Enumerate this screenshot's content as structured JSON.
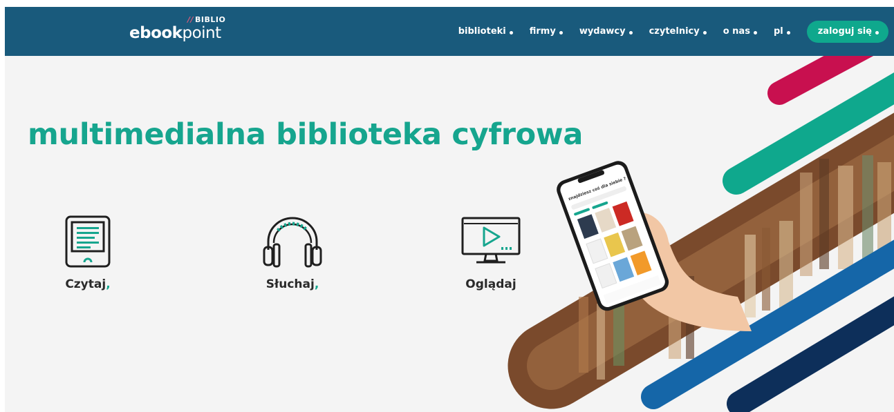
{
  "header": {
    "logo": {
      "biblio": "BIBLIO",
      "brand_bold": "ebook",
      "brand_light": "point"
    },
    "nav": [
      {
        "label": "biblioteki"
      },
      {
        "label": "firmy"
      },
      {
        "label": "wydawcy"
      },
      {
        "label": "czytelnicy"
      },
      {
        "label": "o nas"
      },
      {
        "label": "pl"
      }
    ],
    "login_label": "zaloguj się"
  },
  "hero": {
    "headline": "multimedialna biblioteka cyfrowa",
    "features": [
      {
        "label": "Czytaj",
        "suffix": ",",
        "icon": "ereader-icon"
      },
      {
        "label": "Słuchaj",
        "suffix": ",",
        "icon": "headphones-icon"
      },
      {
        "label": "Oglądaj",
        "suffix": "",
        "icon": "monitor-play-icon"
      }
    ],
    "phone": {
      "app_heading": "znajdziesz coś dla siebie ?"
    }
  },
  "colors": {
    "header_bg": "#195a7c",
    "accent_green": "#16a58e",
    "stripe_crimson": "#c8104f",
    "stripe_blue": "#1566a8",
    "stripe_navy": "#0d2f5a"
  }
}
